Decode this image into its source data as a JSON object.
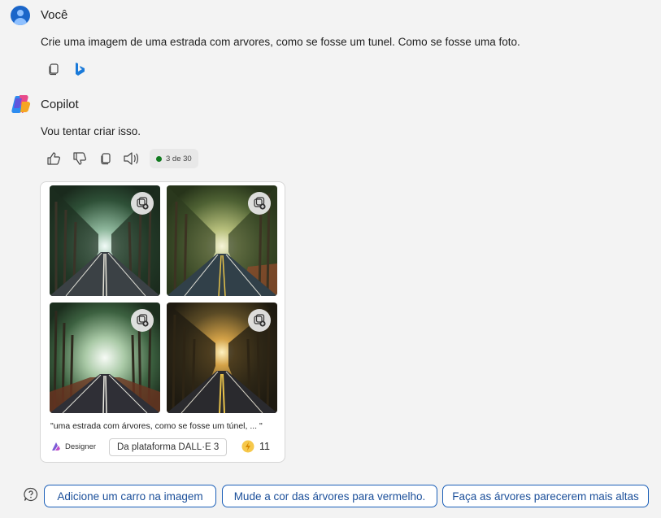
{
  "user_message": {
    "name": "Você",
    "text": "Crie uma imagem de uma estrada com arvores, como se fosse um tunel. Como se fosse uma foto.",
    "actions": [
      {
        "icon": "copy-icon"
      },
      {
        "icon": "bing-icon"
      }
    ]
  },
  "copilot_message": {
    "name": "Copilot",
    "text": "Vou tentar criar isso.",
    "actions": [
      {
        "icon": "thumbs-up-icon"
      },
      {
        "icon": "thumbs-down-icon"
      },
      {
        "icon": "copy-icon"
      },
      {
        "icon": "speaker-icon"
      }
    ],
    "counter": {
      "text": "3 de 30",
      "dot_color": "#117a1f"
    }
  },
  "image_card": {
    "caption": "\"uma estrada com árvores, como se fosse um túnel, ... \"",
    "designer_label": "Designer",
    "platform_label": "Da plataforma DALL·E 3",
    "boost_count": "11",
    "images": [
      {
        "name": "generated-image-1",
        "action_icon": "add-to-collection-icon"
      },
      {
        "name": "generated-image-2",
        "action_icon": "add-to-collection-icon"
      },
      {
        "name": "generated-image-3",
        "action_icon": "add-to-collection-icon"
      },
      {
        "name": "generated-image-4",
        "action_icon": "add-to-collection-icon"
      }
    ]
  },
  "suggestions": [
    "Adicione um carro na imagem",
    "Mude a cor das árvores para vermelho.",
    "Faça as árvores parecerem mais altas"
  ],
  "colors": {
    "background": "#f3f3f3",
    "accent": "#1b5fb8",
    "user_avatar": "#1b66c9"
  }
}
